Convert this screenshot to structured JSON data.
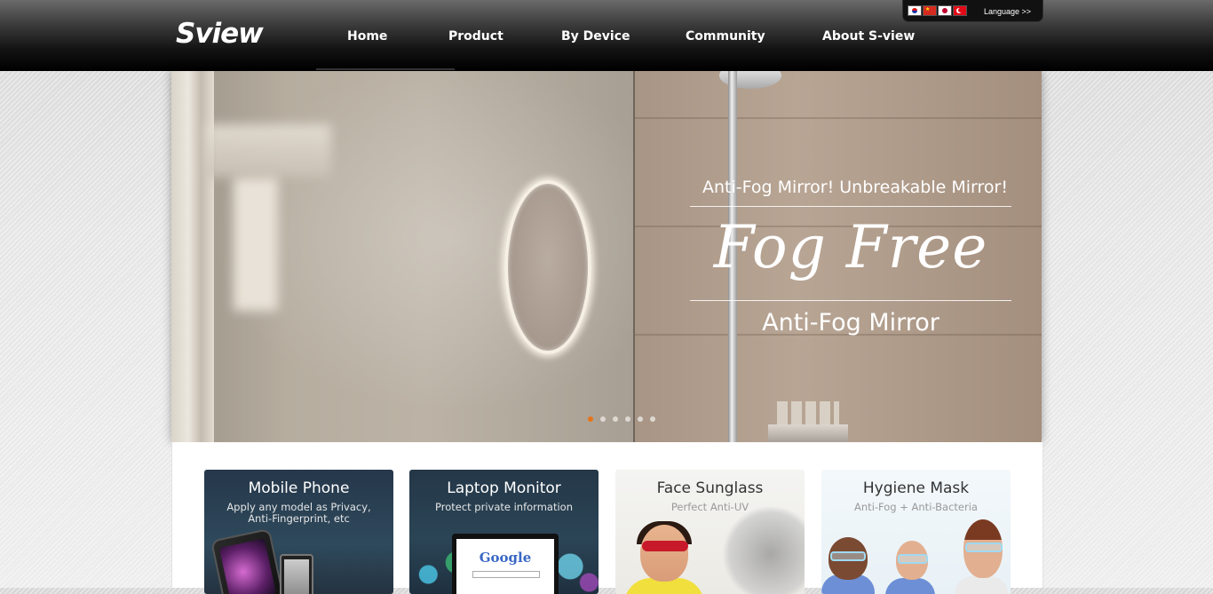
{
  "header": {
    "logo_text": "Sview",
    "nav": [
      "Home",
      "Product",
      "By Device",
      "Community",
      "About S-view"
    ],
    "active_nav": "Home",
    "language": {
      "flags": [
        "korea-flag",
        "china-flag",
        "japan-flag",
        "turkey-flag"
      ],
      "label": "Language >>"
    }
  },
  "hero": {
    "subtitle": "Anti-Fog Mirror!  Unbreakable Mirror!",
    "title": "Fog Free",
    "caption": "Anti-Fog Mirror",
    "slides_count": 6,
    "active_slide": 1
  },
  "cards": [
    {
      "title": "Mobile Phone",
      "subtitle": "Apply any model as Privacy, Anti-Fingerprint, etc"
    },
    {
      "title": "Laptop Monitor",
      "subtitle": "Protect private information",
      "screen_text": "Google"
    },
    {
      "title": "Face Sunglass",
      "subtitle": "Perfect Anti-UV"
    },
    {
      "title": "Hygiene Mask",
      "subtitle": "Anti-Fog + Anti-Bacteria"
    }
  ],
  "colors": {
    "accent_dot": "#e8731c",
    "header_dark": "#000000"
  }
}
